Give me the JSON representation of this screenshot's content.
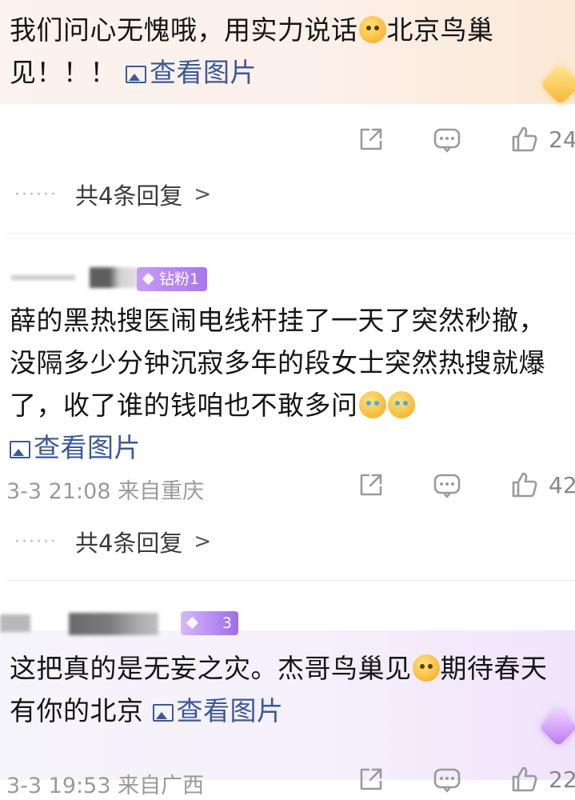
{
  "comments": [
    {
      "text_parts": [
        "我们问心无愧哦，用实力说话",
        "北京鸟巢见！！！ "
      ],
      "view_pic": "查看图片",
      "like_count": "24",
      "replies": "共4条回复"
    },
    {
      "badge": "钻粉1",
      "text_parts": [
        "薛的黑热搜医闹电线杆挂了一天了突然秒撤，没隔多少分钟沉寂多年的段女士突然热搜就爆了，收了谁的钱咱也不敢多问"
      ],
      "view_pic": "查看图片",
      "meta": "3-3 21:08 来自重庆",
      "like_count": "42",
      "replies": "共4条回复"
    },
    {
      "badge": "3",
      "text_parts": [
        "这把真的是无妄之灾。杰哥鸟巢见",
        "期待春天有你的北京 "
      ],
      "view_pic": "查看图片",
      "meta": "3-3 19:53 来自广西",
      "like_count": "22"
    }
  ],
  "icons": {
    "share": "share-icon",
    "comment": "comment-icon",
    "like": "thumbs-up-icon",
    "chevron": "chevron-right-icon",
    "image": "image-icon"
  },
  "colors": {
    "link": "#3b5998",
    "meta": "#9a9a9a",
    "badge_purple": "#a876ee"
  }
}
